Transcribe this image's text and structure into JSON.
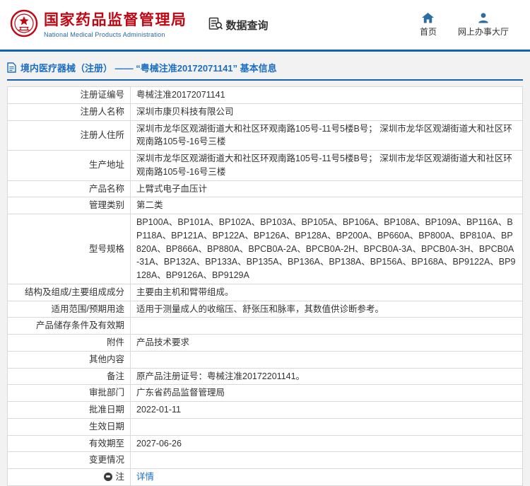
{
  "colors": {
    "brand_red": "#c00714",
    "accent_blue": "#1563af",
    "link_blue": "#1b6ec2",
    "icon_blue": "#2e6da4",
    "border_gray": "#d9d9d9",
    "page_bg": "#f2f2f2"
  },
  "header": {
    "title": "国家药品监督管理局",
    "subtitle": "National Medical Products Administration",
    "data_query_label": "数据查询",
    "nav": [
      {
        "label": "首页"
      },
      {
        "label": "网上办事大厅"
      }
    ]
  },
  "breadcrumb": {
    "text": "境内医疗器械（注册） —— “粤械注准20172071141” 基本信息"
  },
  "table": {
    "rows": [
      {
        "label": "注册证编号",
        "value": "粤械注准20172071141"
      },
      {
        "label": "注册人名称",
        "value": "深圳市康贝科技有限公司"
      },
      {
        "label": "注册人住所",
        "value": "深圳市龙华区观湖街道大和社区环观南路105号-11号5楼B号； 深圳市龙华区观湖街道大和社区环观南路105号-16号三楼"
      },
      {
        "label": "生产地址",
        "value": "深圳市龙华区观湖街道大和社区环观南路105号-11号5楼B号； 深圳市龙华区观湖街道大和社区环观南路105号-16号三楼"
      },
      {
        "label": "产品名称",
        "value": "上臂式电子血压计"
      },
      {
        "label": "管理类别",
        "value": "第二类"
      },
      {
        "label": "型号规格",
        "value": "BP100A、BP101A、BP102A、BP103A、BP105A、BP106A、BP108A、BP109A、BP116A、BP118A、BP121A、BP122A、BP126A、BP128A、BP200A、BP660A、BP800A、BP810A、BP820A、BP866A、BP880A、BPCB0A-2A、BPCB0A-2H、BPCB0A-3A、BPCB0A-3H、BPCB0A-31A、BP132A、BP133A、BP135A、BP136A、BP138A、BP156A、BP168A、BP9122A、BP9128A、BP9126A、BP9129A"
      },
      {
        "label": "结构及组成/主要组成成分",
        "value": "主要由主机和臂带组成。"
      },
      {
        "label": "适用范围/预期用途",
        "value": "适用于测量成人的收缩压、舒张压和脉率，其数值供诊断参考。"
      },
      {
        "label": "产品储存条件及有效期",
        "value": ""
      },
      {
        "label": "附件",
        "value": "产品技术要求"
      },
      {
        "label": "其他内容",
        "value": ""
      },
      {
        "label": "备注",
        "value": "原产品注册证号：粤械注准20172201141。"
      },
      {
        "label": "审批部门",
        "value": "广东省药品监督管理局"
      },
      {
        "label": "批准日期",
        "value": "2022-01-11"
      },
      {
        "label": "生效日期",
        "value": ""
      },
      {
        "label": "有效期至",
        "value": "2027-06-26"
      },
      {
        "label": "变更情况",
        "value": ""
      },
      {
        "label": "注",
        "value": "详情",
        "link": true,
        "icon": "note-icon"
      }
    ]
  }
}
